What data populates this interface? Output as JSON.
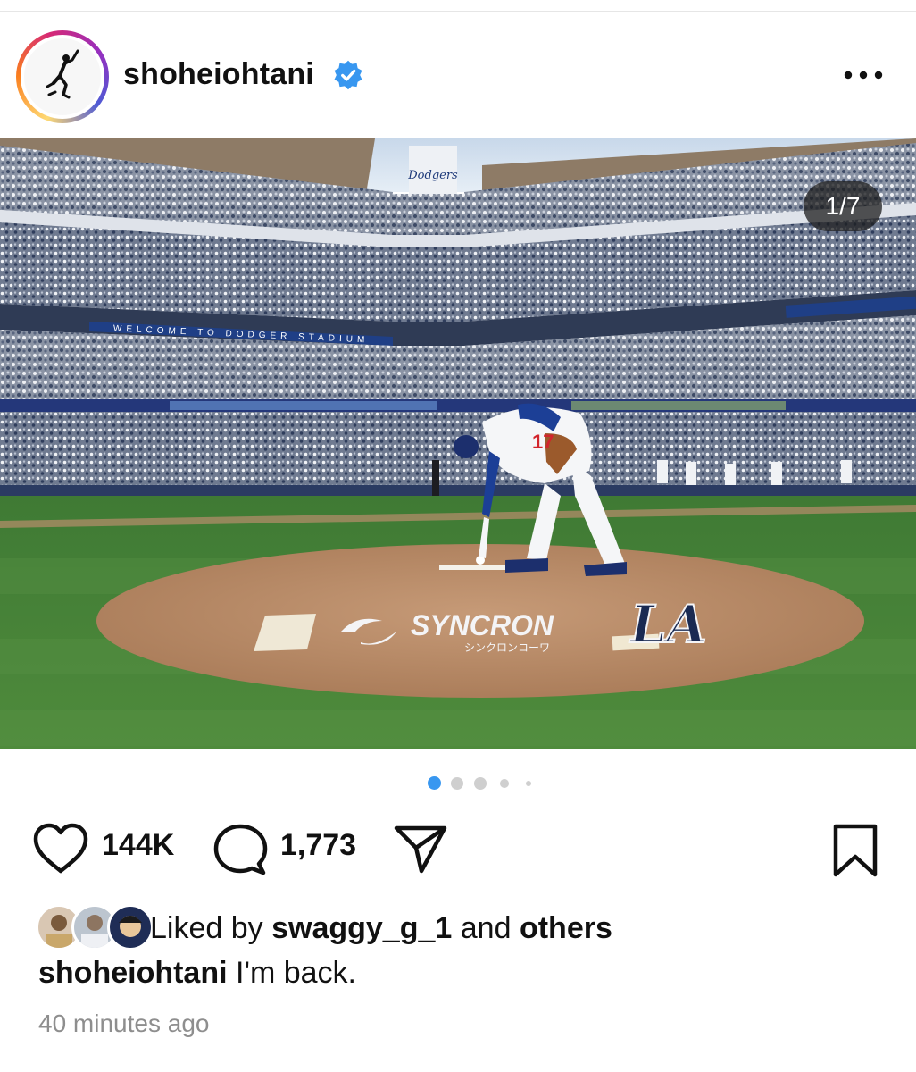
{
  "post": {
    "username": "shoheiohtani",
    "verified": true,
    "menu_icon": "more-horizontal-icon",
    "slide_counter": "1/7",
    "image": {
      "mound_sponsor": "SYNCRON",
      "mound_sponsor_sub": "シンクロンコーワ",
      "mound_logo": "LA",
      "banner_text": "WELCOME TO DODGER STADIUM",
      "scoreboard_text": "Dodgers",
      "jersey_number": "17"
    },
    "carousel": {
      "total_dots_visible": 5,
      "active_index": 0,
      "accent": "#3897f0"
    },
    "actions": {
      "like_icon": "heart-icon",
      "like_count": "144K",
      "comment_icon": "comment-icon",
      "comment_count": "1,773",
      "share_icon": "send-icon",
      "save_icon": "bookmark-icon"
    },
    "likes": {
      "prefix": "Liked by",
      "user": "swaggy_g_1",
      "conjunction": "and",
      "others": "others"
    },
    "caption": {
      "username": "shoheiohtani",
      "text": "I'm back."
    },
    "timestamp": "40 minutes ago"
  }
}
